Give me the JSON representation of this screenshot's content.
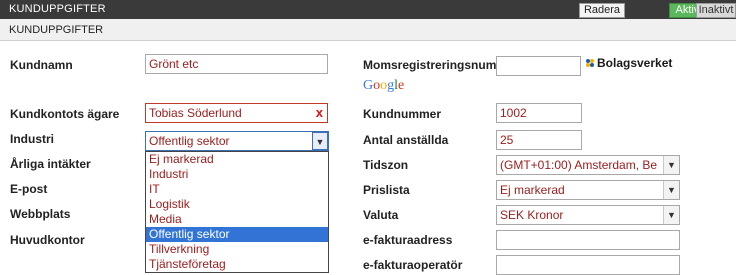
{
  "header": {
    "title": "KUNDUPPGIFTER",
    "buttons": {
      "delete": "Radera",
      "active": "Aktiva",
      "inactive": "Inaktivt"
    }
  },
  "subheader": {
    "title": "KUNDUPPGIFTER"
  },
  "left": {
    "customer_name": {
      "label": "Kundnamn",
      "value": "Grönt etc"
    },
    "account_owner": {
      "label": "Kundkontots ägare",
      "value": "Tobias Söderlund",
      "clear": "x"
    },
    "industry": {
      "label": "Industri",
      "value": "Offentlig sektor"
    },
    "annual_revenue": {
      "label": "Årliga intäkter"
    },
    "email": {
      "label": "E-post"
    },
    "website": {
      "label": "Webbplats"
    },
    "head_office": {
      "label": "Huvudkontor"
    }
  },
  "industry_dropdown": {
    "options": [
      "Ej markerad",
      "Industri",
      "IT",
      "Logistik",
      "Media",
      "Offentlig sektor",
      "Tillverkning",
      "Tjänsteföretag"
    ],
    "selected_index": 5
  },
  "right": {
    "vat": {
      "label": "Momsregistreringsnum",
      "value": ""
    },
    "bolagsverket": "Bolagsverket",
    "google": [
      "G",
      "o",
      "o",
      "g",
      "l",
      "e"
    ],
    "customer_number": {
      "label": "Kundnummer",
      "value": "1002"
    },
    "employees": {
      "label": "Antal anställda",
      "value": "25"
    },
    "timezone": {
      "label": "Tidszon",
      "value": "(GMT+01:00) Amsterdam, Be"
    },
    "price_list": {
      "label": "Prislista",
      "value": "Ej markerad"
    },
    "currency": {
      "label": "Valuta",
      "value": "SEK Kronor"
    },
    "einvoice_address": {
      "label": "e-fakturaadress",
      "value": ""
    },
    "einvoice_operator": {
      "label": "e-fakturaoperatör",
      "value": ""
    }
  },
  "colors": {
    "header_bg": "#3a3a3a",
    "active_green": "#5cb85c",
    "value_text": "#9b1c1c",
    "highlight": "#3174d6",
    "google": [
      "#3b78e7",
      "#d93025",
      "#f4b400",
      "#3b78e7",
      "#188038",
      "#d93025"
    ]
  }
}
